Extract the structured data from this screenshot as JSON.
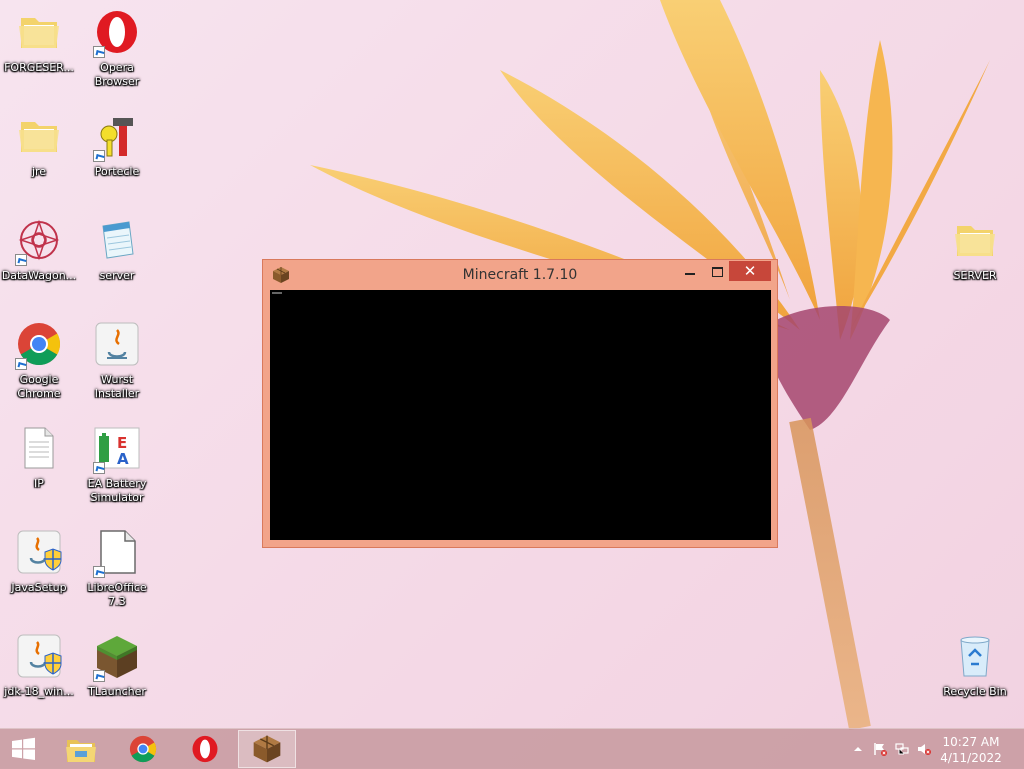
{
  "desktop": {
    "icons_left_col1": [
      {
        "label": "FORGESER...",
        "icon": "folder-icon"
      },
      {
        "label": "jre",
        "icon": "folder-icon"
      },
      {
        "label": "DataWagon...",
        "icon": "datawagon-icon"
      },
      {
        "label": "Google Chrome",
        "icon": "chrome-icon"
      },
      {
        "label": "IP",
        "icon": "text-document-icon"
      },
      {
        "label": "JavaSetup",
        "icon": "java-setup-icon"
      },
      {
        "label": "jdk-18_win...",
        "icon": "java-setup-icon"
      }
    ],
    "icons_left_col2": [
      {
        "label": "Opera Browser",
        "icon": "opera-icon"
      },
      {
        "label": "Portecle",
        "icon": "portecle-icon"
      },
      {
        "label": "server",
        "icon": "notepad-icon"
      },
      {
        "label": "Wurst Installer",
        "icon": "java-icon"
      },
      {
        "label": "EA Battery Simulator",
        "icon": "ea-battery-icon"
      },
      {
        "label": "LibreOffice 7.3",
        "icon": "libreoffice-icon"
      },
      {
        "label": "TLauncher",
        "icon": "grass-block-icon"
      }
    ],
    "icons_right": [
      {
        "label": "SERVER",
        "icon": "folder-icon"
      },
      {
        "label": "Recycle Bin",
        "icon": "recycle-bin-icon"
      }
    ]
  },
  "window": {
    "title": "Minecraft 1.7.10",
    "close_glyph": "✕",
    "app_icon": "crafting-table-icon"
  },
  "taskbar": {
    "start_icon": "windows-logo-icon",
    "apps": [
      {
        "name": "file-explorer",
        "icon": "file-explorer-icon",
        "active": false
      },
      {
        "name": "chrome",
        "icon": "chrome-icon",
        "active": false
      },
      {
        "name": "opera",
        "icon": "opera-icon",
        "active": false
      },
      {
        "name": "minecraft",
        "icon": "crafting-table-icon",
        "active": true
      }
    ],
    "tray": {
      "icons": [
        "show-hidden-icon",
        "action-center-flag-icon",
        "network-icon",
        "volume-muted-icon"
      ],
      "time": "10:27 AM",
      "date": "4/11/2022"
    }
  },
  "colors": {
    "window_frame": "#f2a48a",
    "close_button": "#c7473a",
    "taskbar": "#c4969b"
  }
}
